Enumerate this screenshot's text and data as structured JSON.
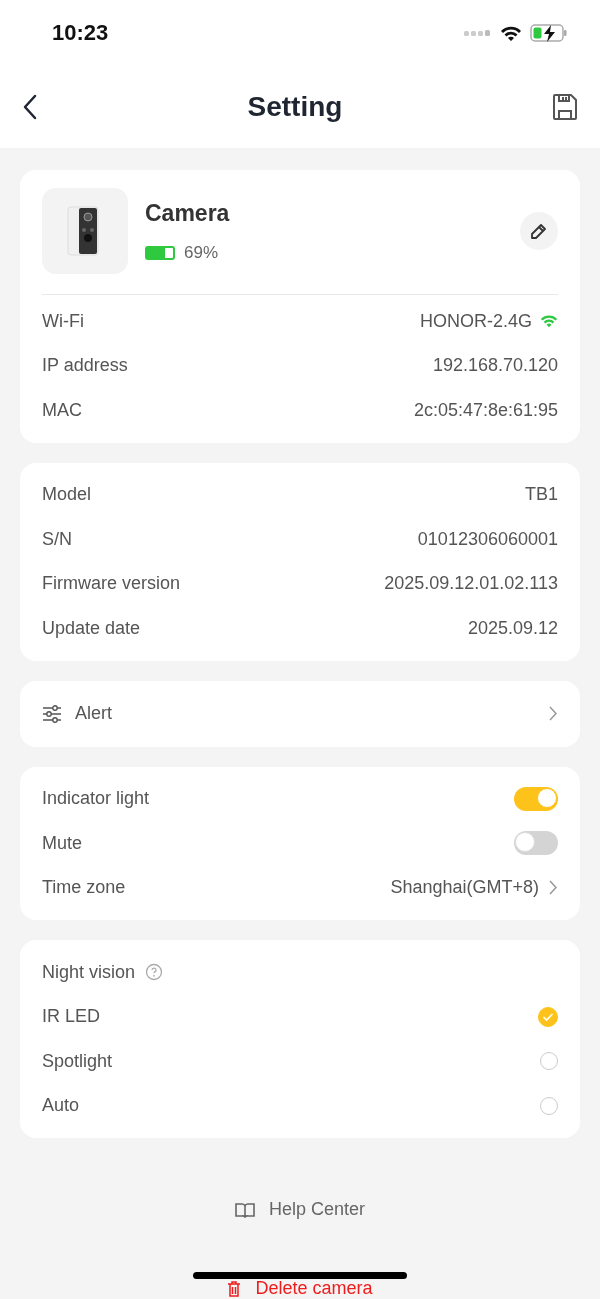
{
  "status_bar": {
    "time": "10:23"
  },
  "header": {
    "title": "Setting"
  },
  "device": {
    "name": "Camera",
    "battery": {
      "level": 0.69,
      "reading": "69%"
    },
    "network": [
      {
        "label": "Wi-Fi",
        "value": "HONOR-2.4G",
        "kind": "wifi"
      },
      {
        "label": "IP address",
        "value": "192.168.70.120",
        "kind": "text"
      },
      {
        "label": "MAC",
        "value": "2c:05:47:8e:61:95",
        "kind": "text"
      }
    ]
  },
  "info": [
    {
      "label": "Model",
      "value": "TB1"
    },
    {
      "label": "S/N",
      "value": "01012306060001"
    },
    {
      "label": "Firmware version",
      "value": "2025.09.12.01.02.113"
    },
    {
      "label": "Update date",
      "value": "2025.09.12"
    }
  ],
  "alert": {
    "label": "Alert"
  },
  "settings": [
    {
      "kind": "toggle",
      "label": "Indicator light",
      "on": true
    },
    {
      "kind": "toggle",
      "label": "Mute",
      "on": false
    },
    {
      "kind": "link",
      "label": "Time zone",
      "value": "Shanghai(GMT+8)"
    }
  ],
  "night_vision": {
    "title": "Night vision",
    "options": [
      {
        "label": "IR LED",
        "selected": true
      },
      {
        "label": "Spotlight",
        "selected": false
      },
      {
        "label": "Auto",
        "selected": false
      }
    ]
  },
  "help": {
    "label": "Help Center"
  },
  "delete": {
    "label": "Delete camera"
  }
}
